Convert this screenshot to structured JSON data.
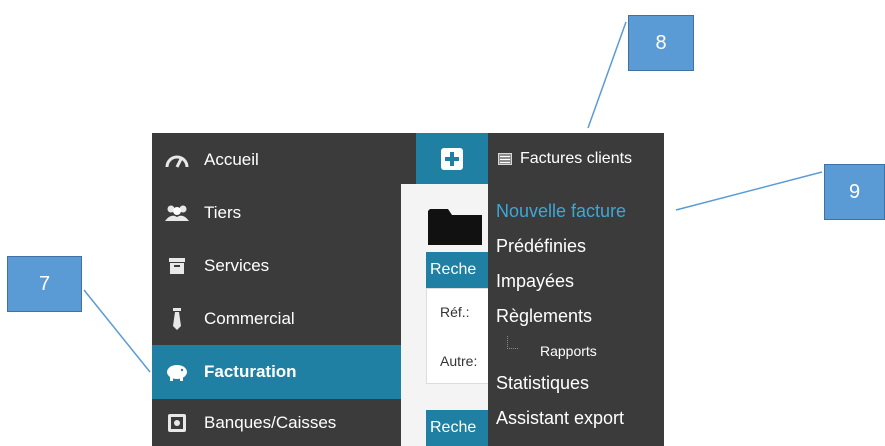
{
  "sidebar": {
    "items": [
      {
        "label": "Accueil",
        "icon": "dashboard-gauge-icon",
        "active": false
      },
      {
        "label": "Tiers",
        "icon": "users-icon",
        "active": false
      },
      {
        "label": "Services",
        "icon": "archive-box-icon",
        "active": false
      },
      {
        "label": "Commercial",
        "icon": "tie-icon",
        "active": false
      },
      {
        "label": "Facturation",
        "icon": "piggy-bank-icon",
        "active": true
      },
      {
        "label": "Banques/Caisses",
        "icon": "safe-icon",
        "active": false
      }
    ]
  },
  "main": {
    "panel1_head": "Reche",
    "field_ref": "Réf.:",
    "field_autre": "Autre:",
    "panel2_head": "Reche"
  },
  "menu": {
    "header": "Factures clients",
    "items": [
      {
        "label": "Nouvelle facture",
        "highlighted": true
      },
      {
        "label": "Prédéfinies"
      },
      {
        "label": "Impayées"
      },
      {
        "label": "Règlements"
      },
      {
        "label": "Rapports",
        "sub": true
      },
      {
        "label": "Statistiques"
      },
      {
        "label": "Assistant export"
      }
    ]
  },
  "callouts": {
    "c7": "7",
    "c8": "8",
    "c9": "9"
  },
  "colors": {
    "sidebar_bg": "#3b3b3b",
    "accent": "#1f80a3",
    "highlight_text": "#3fa7d6",
    "callout": "#5b9bd5"
  }
}
